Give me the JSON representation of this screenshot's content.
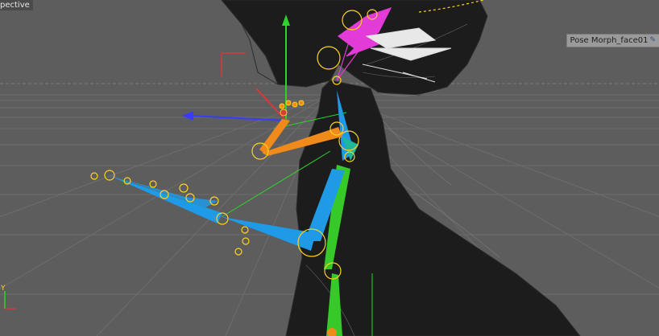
{
  "viewport": {
    "view_label": "pective",
    "object_tag": "Pose Morph_face01",
    "tag_icon": "pin-icon",
    "axis_corner_label": "Y"
  },
  "colors": {
    "background": "#5d5d5d",
    "grid": "#6d6d6d",
    "mesh": "#1c1c1c",
    "bone_blue": "#1e9ae6",
    "bone_orange": "#f08a1a",
    "bone_green": "#37c82a",
    "bone_magenta": "#e23bd7",
    "joint_yellow": "#ffd21e",
    "axis_x": "#d63a3a",
    "axis_y": "#2ed12e",
    "axis_z": "#3a3aff"
  }
}
